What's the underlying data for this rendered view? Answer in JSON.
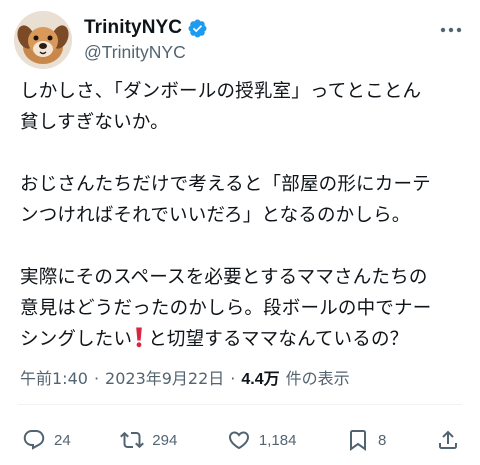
{
  "author": {
    "display_name": "TrinityNYC",
    "handle": "@TrinityNYC"
  },
  "tweet": {
    "paragraphs": [
      [
        "しかしさ、「ダンボールの授乳室」ってとことん",
        "貧しすぎないか。"
      ],
      [
        "おじさんたちだけで考えると「部屋の形にカーテ",
        "ンつければそれでいいだろ」となるのかしら。"
      ],
      [
        "実際にそのスペースを必要とするママさんたちの",
        "意見はどうだったのかしら。段ボールの中でナー"
      ]
    ],
    "last_line_before_emoji": "シングしたい",
    "last_line_after_emoji": "と切望するママなんているの？",
    "emoji": "exclamation-mark-emoji"
  },
  "meta": {
    "time": "午前1:40",
    "separator": "·",
    "date": "2023年9月22日",
    "views_count": "4.4万",
    "views_label": "件の表示"
  },
  "actions": {
    "replies": "24",
    "retweets": "294",
    "likes": "1,184",
    "bookmarks": "8"
  },
  "colors": {
    "text": "#0f1419",
    "secondary": "#536471",
    "verified": "#1d9bf0",
    "emoji_red": "#d7263d"
  }
}
